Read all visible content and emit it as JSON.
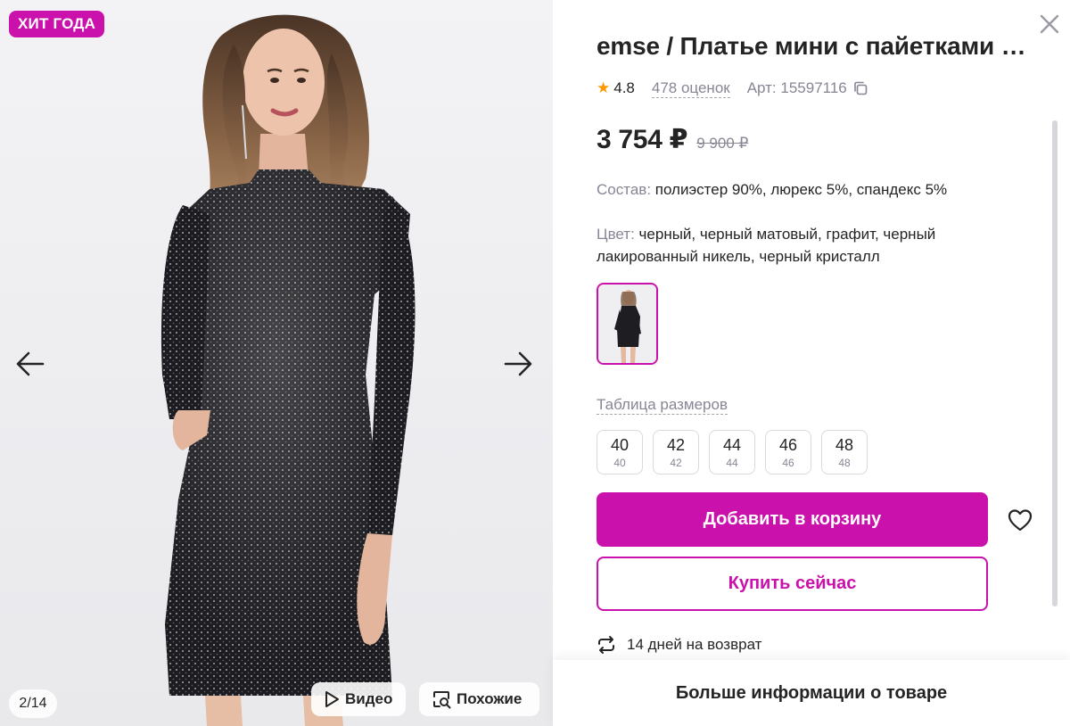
{
  "gallery": {
    "badge": "ХИТ ГОДА",
    "counter": "2/14",
    "video_label": "Видео",
    "similar_label": "Похожие"
  },
  "product": {
    "title": "emse / Платье мини с пайетками …",
    "rating": "4.8",
    "reviews": "478 оценок",
    "article": "Арт: 15597116",
    "price": "3 754 ₽",
    "old_price": "9 900 ₽",
    "composition_label": "Состав:",
    "composition_value": " полиэстер 90%, люрекс 5%, спандекс 5%",
    "color_label": "Цвет:",
    "color_value": " черный, черный матовый, графит, черный лакированный никель, черный кристалл",
    "size_table_link": "Таблица размеров",
    "sizes": [
      {
        "main": "40",
        "sub": "40"
      },
      {
        "main": "42",
        "sub": "42"
      },
      {
        "main": "44",
        "sub": "44"
      },
      {
        "main": "46",
        "sub": "46"
      },
      {
        "main": "48",
        "sub": "48"
      }
    ],
    "add_to_cart": "Добавить в корзину",
    "buy_now": "Купить сейчас",
    "returns": "14 дней на возврат",
    "more_info": "Больше информации о товаре"
  },
  "colors": {
    "accent": "#cb11ab",
    "star": "#ff9800",
    "muted_text": "#868695",
    "text": "#242424"
  },
  "icons": {
    "close": "close-icon",
    "arrow_left": "arrow-left-icon",
    "arrow_right": "arrow-right-icon",
    "play": "play-icon",
    "search_similar": "image-search-icon",
    "star": "star-icon",
    "copy": "copy-icon",
    "heart": "heart-icon",
    "return": "return-arrows-icon"
  }
}
